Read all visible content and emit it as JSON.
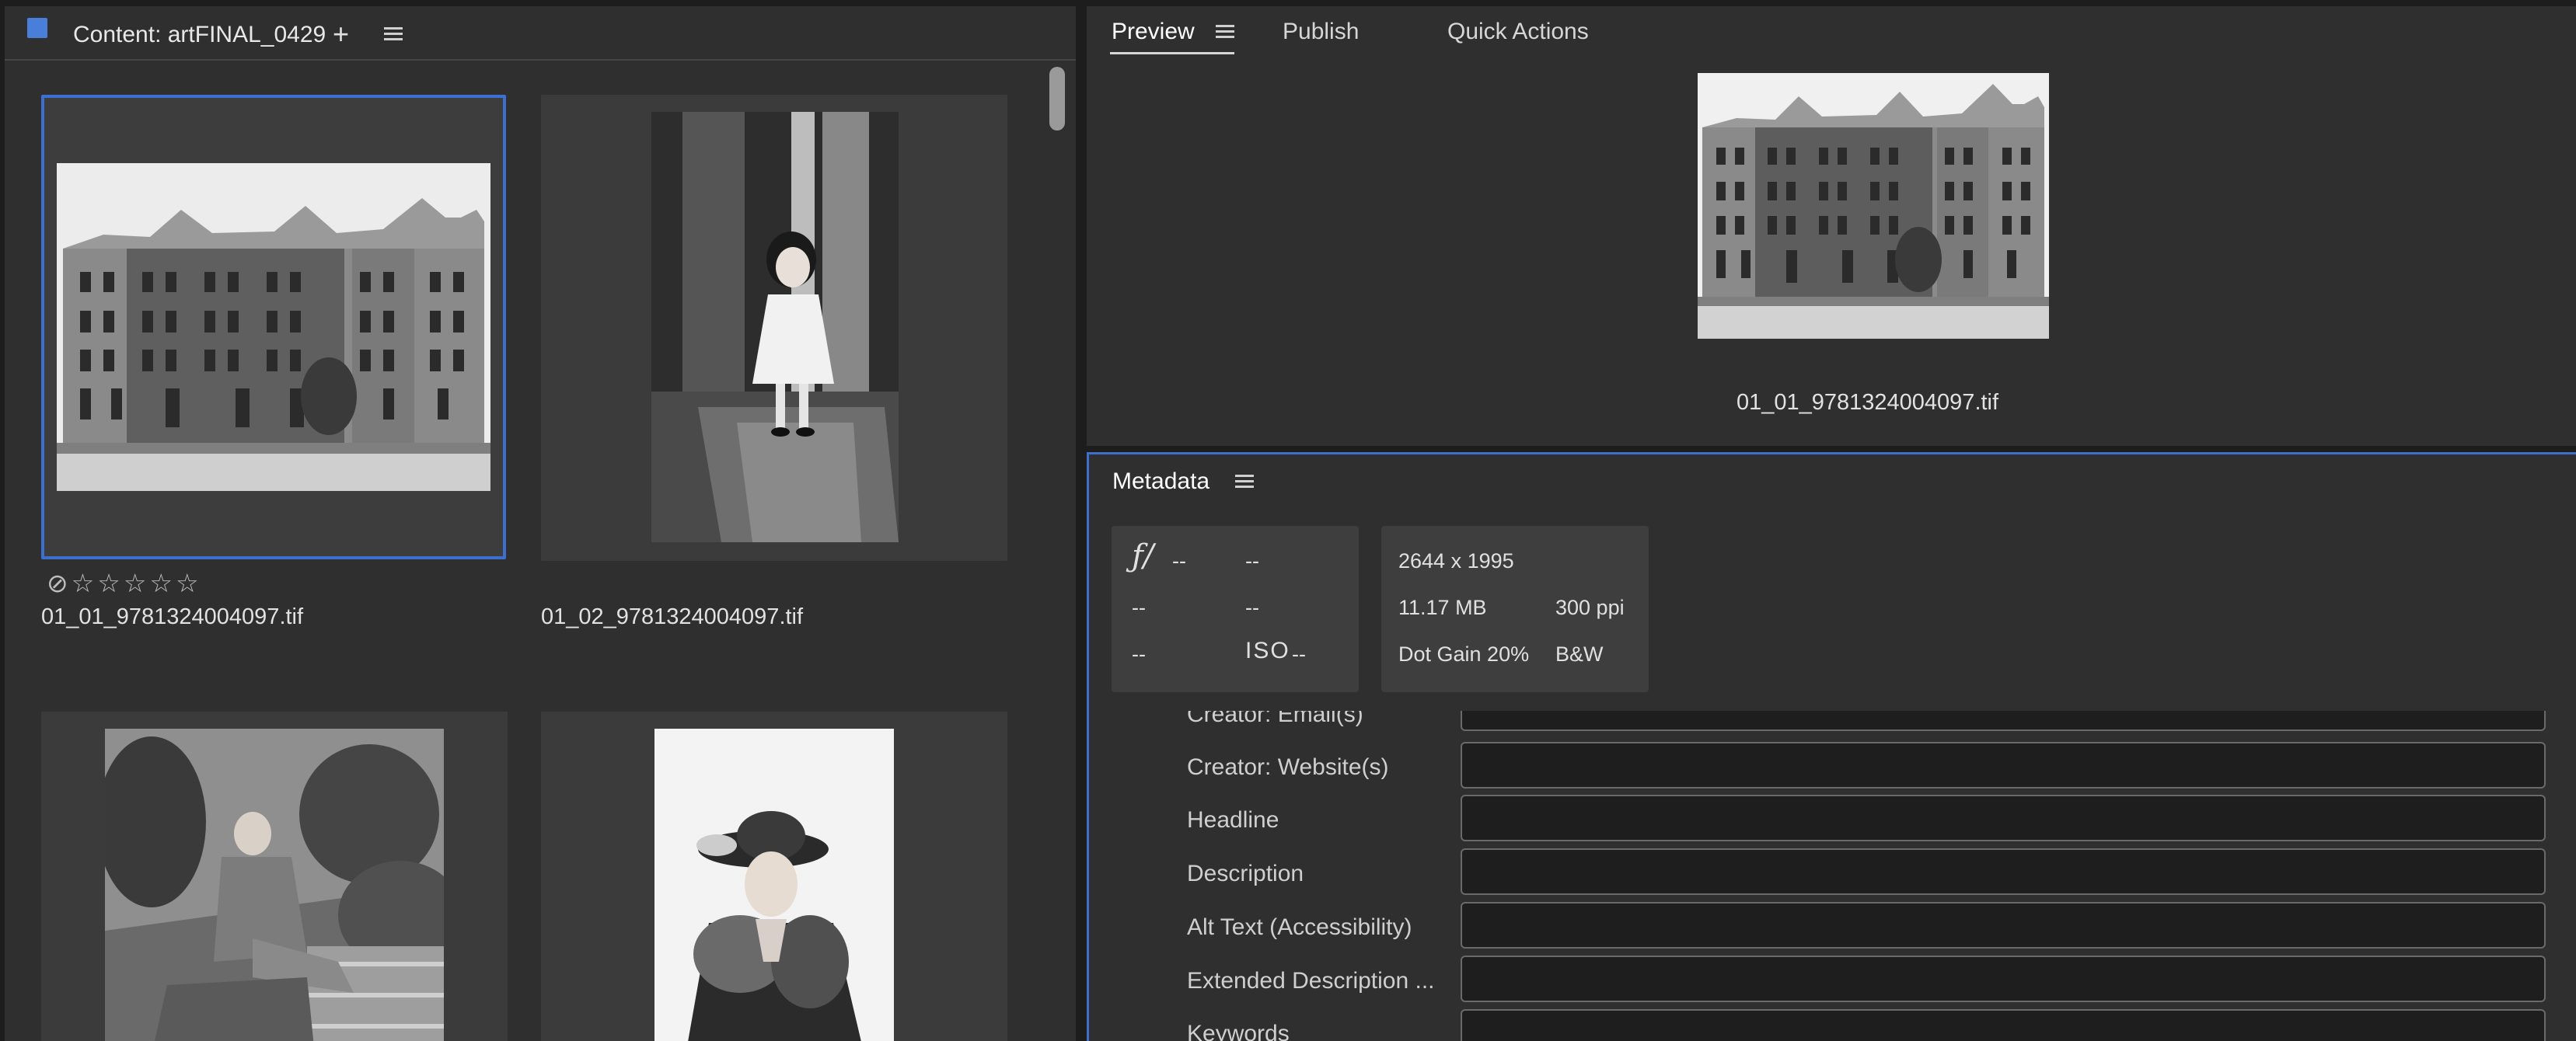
{
  "content": {
    "title": "Content: artFINAL_0429",
    "add_icon": "plus-icon",
    "menu_icon": "hamburger-menu-icon",
    "accent_color": "#4a7fd9",
    "items": [
      {
        "filename": "01_01_9781324004097.tif",
        "selected": true,
        "rating": 0
      },
      {
        "filename": "01_02_9781324004097.tif",
        "selected": false
      },
      {
        "filename": "",
        "selected": false
      },
      {
        "filename": "",
        "selected": false
      }
    ],
    "rating_icons": [
      "reject-icon",
      "star-icon",
      "star-icon",
      "star-icon",
      "star-icon",
      "star-icon"
    ]
  },
  "preview": {
    "tabs": [
      "Preview",
      "Publish",
      "Quick Actions"
    ],
    "active_tab": "Preview",
    "filename": "01_01_9781324004097.tif"
  },
  "metadata": {
    "title": "Metadata",
    "camera": {
      "aperture_symbol": "ƒ/",
      "aperture": "--",
      "shutter": "--",
      "r2c1": "--",
      "r2c2": "--",
      "r3c1": "--",
      "iso_label": "ISO",
      "iso": "--"
    },
    "file_info": {
      "dimensions": "2644 x 1995",
      "size": "11.17 MB",
      "resolution": "300 ppi",
      "dot_gain": "Dot Gain 20%",
      "color_mode": "B&W"
    },
    "fields": [
      {
        "label": "Creator: Email(s)",
        "value": ""
      },
      {
        "label": "Creator: Website(s)",
        "value": ""
      },
      {
        "label": "Headline",
        "value": ""
      },
      {
        "label": "Description",
        "value": ""
      },
      {
        "label": "Alt Text (Accessibility)",
        "value": ""
      },
      {
        "label": "Extended Description ...",
        "value": ""
      },
      {
        "label": "Keywords",
        "value": ""
      }
    ]
  }
}
